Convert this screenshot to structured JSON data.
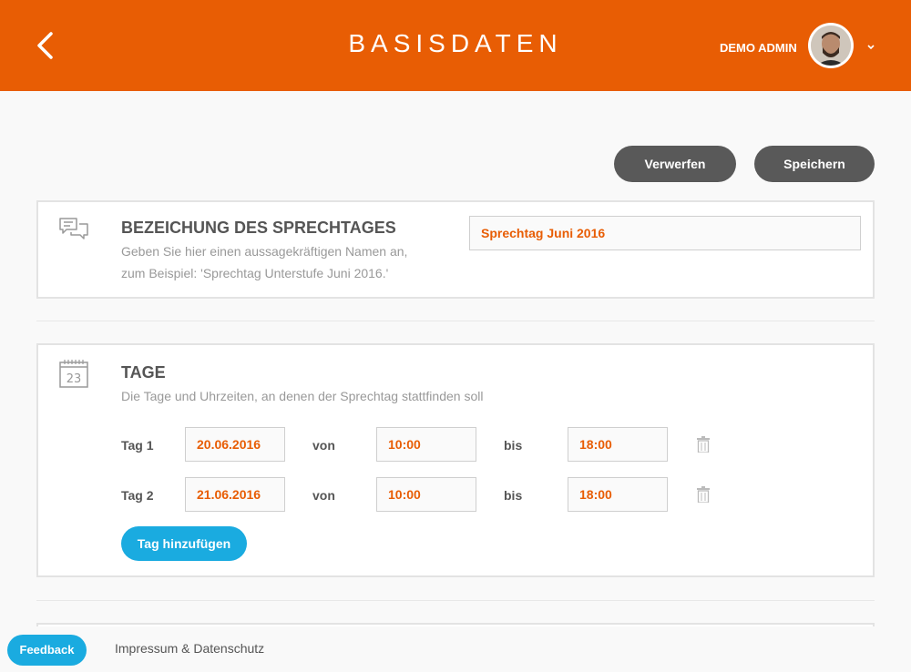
{
  "header": {
    "title": "BASISDATEN",
    "user_name": "DEMO ADMIN",
    "accent_color": "#e85d04"
  },
  "actions": {
    "discard_label": "Verwerfen",
    "save_label": "Speichern"
  },
  "name_section": {
    "icon": "speech-bubbles-icon",
    "title": "BEZEICHUNG DES SPRECHTAGES",
    "desc_line1": "Geben Sie hier einen aussagekräftigen Namen an,",
    "desc_line2": "zum Beispiel: 'Sprechtag Unterstufe Juni 2016.'",
    "value": "Sprechtag Juni 2016"
  },
  "days_section": {
    "icon": "calendar-icon",
    "icon_text": "23",
    "title": "TAGE",
    "desc": "Die Tage und Uhrzeiten, an denen der Sprechtag stattfinden soll",
    "from_label": "von",
    "to_label": "bis",
    "rows": [
      {
        "label": "Tag 1",
        "date": "20.06.2016",
        "from": "10:00",
        "to": "18:00"
      },
      {
        "label": "Tag 2",
        "date": "21.06.2016",
        "from": "10:00",
        "to": "18:00"
      }
    ],
    "add_label": "Tag hinzufügen"
  },
  "footer": {
    "feedback_label": "Feedback",
    "imprint_label": "Impressum & Datenschutz"
  }
}
